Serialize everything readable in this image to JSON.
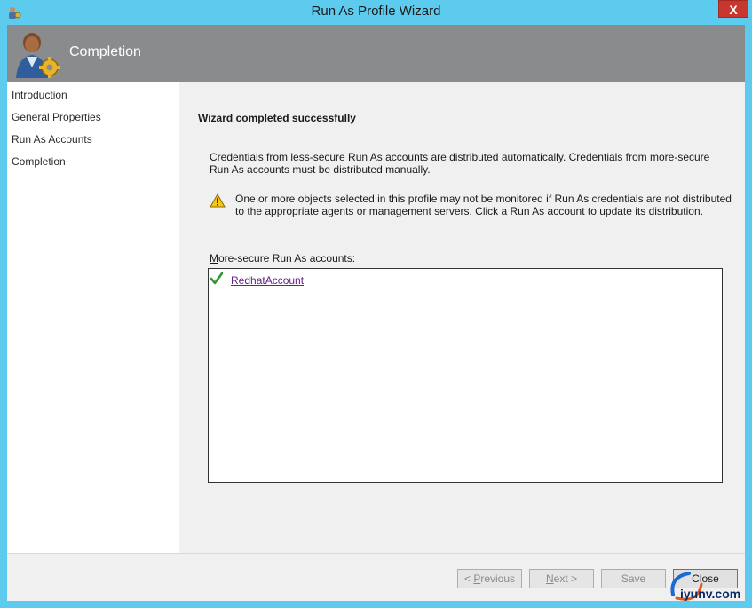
{
  "window": {
    "title": "Run As Profile Wizard",
    "close_glyph": "X"
  },
  "banner": {
    "title": "Completion"
  },
  "sidebar": {
    "items": [
      {
        "label": "Introduction"
      },
      {
        "label": "General Properties"
      },
      {
        "label": "Run As Accounts"
      },
      {
        "label": "Completion"
      }
    ]
  },
  "main": {
    "section_title": "Wizard completed successfully",
    "info_text": "Credentials from less-secure Run As accounts are distributed automatically. Credentials from more-secure Run As accounts must be distributed manually.",
    "warning_text": "One or more objects selected in this profile may not be monitored if Run As credentials are not distributed to the appropriate agents or management servers. Click a Run As account to update its distribution.",
    "list_label_mnemonic": "M",
    "list_label_rest": "ore-secure Run As accounts:",
    "accounts": [
      {
        "name": "RedhatAccount",
        "status_icon": "checkmark-icon"
      }
    ]
  },
  "footer": {
    "previous_mnemonic": "P",
    "previous_label_pre": "< ",
    "previous_label_rest": "revious",
    "next_mnemonic": "N",
    "next_label_rest": "ext >",
    "save_label": "Save",
    "close_label": "Close"
  },
  "watermark": {
    "text": "iyunv.com"
  },
  "colors": {
    "titlebar": "#5ccbee",
    "banner": "#898b8c",
    "link": "#6a1f8a",
    "close_button": "#c7372f"
  }
}
